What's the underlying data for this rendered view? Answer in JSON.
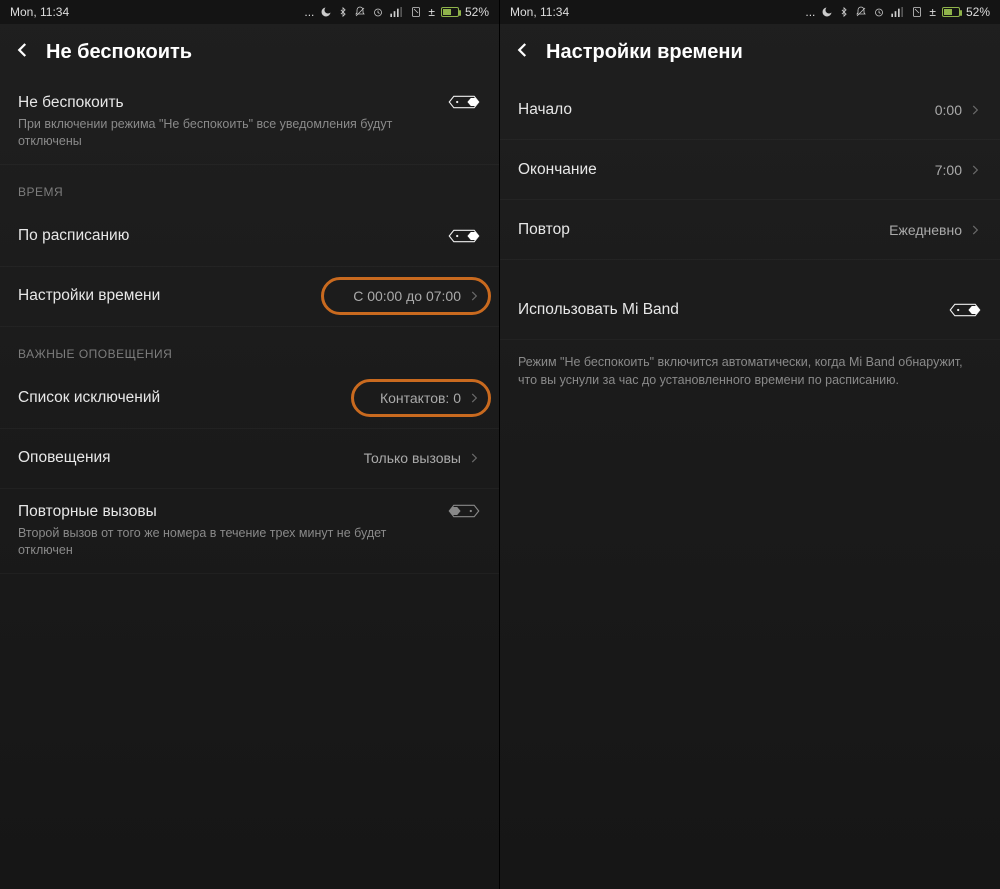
{
  "status": {
    "time": "Mon, 11:34",
    "battery_pct": "52%"
  },
  "left": {
    "header_title": "Не беспокоить",
    "dnd": {
      "title": "Не беспокоить",
      "sub": "При включении режима \"Не беспокоить\" все уведомления будут отключены"
    },
    "section_time": "ВРЕМЯ",
    "scheduled": {
      "title": "По расписанию"
    },
    "time_settings": {
      "title": "Настройки времени",
      "value": "С 00:00 до 07:00"
    },
    "section_important": "ВАЖНЫЕ ОПОВЕЩЕНИЯ",
    "exceptions": {
      "title": "Список исключений",
      "value": "Контактов: 0"
    },
    "notifications": {
      "title": "Оповещения",
      "value": "Только вызовы"
    },
    "repeat_calls": {
      "title": "Повторные вызовы",
      "sub": "Второй вызов от того же номера в течение трех минут не будет отключен"
    }
  },
  "right": {
    "header_title": "Настройки времени",
    "start": {
      "title": "Начало",
      "value": "0:00"
    },
    "end": {
      "title": "Окончание",
      "value": "7:00"
    },
    "repeat": {
      "title": "Повтор",
      "value": "Ежедневно"
    },
    "miband": {
      "title": "Использовать Mi Band"
    },
    "miband_desc": "Режим \"Не беспокоить\" включится автоматически, когда Mi Band обнаружит, что вы уснули за час до установленного времени по расписанию."
  }
}
